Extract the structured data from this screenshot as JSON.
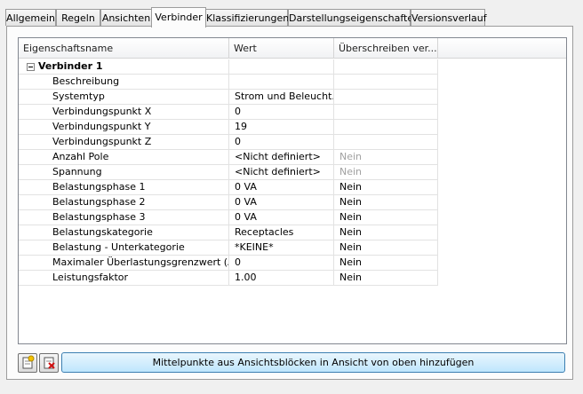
{
  "tabs": [
    {
      "label": "Allgemein",
      "active": false
    },
    {
      "label": "Regeln",
      "active": false
    },
    {
      "label": "Ansichten",
      "active": false
    },
    {
      "label": "Verbinder",
      "active": true
    },
    {
      "label": "Klassifizierungen",
      "active": false
    },
    {
      "label": "Darstellungseigenschaften",
      "active": false
    },
    {
      "label": "Versionsverlauf",
      "active": false
    }
  ],
  "grid": {
    "columns": [
      "Eigenschaftsname",
      "Wert",
      "Überschreiben ver..."
    ],
    "group": {
      "label": "Verbinder 1",
      "expander_icon": "collapse-minus-icon"
    },
    "rows": [
      {
        "name": "Beschreibung",
        "value": "",
        "override": ""
      },
      {
        "name": "Systemtyp",
        "value": "Strom und Beleucht...",
        "override": ""
      },
      {
        "name": "Verbindungspunkt X",
        "value": "0",
        "override": ""
      },
      {
        "name": "Verbindungspunkt Y",
        "value": "19",
        "override": ""
      },
      {
        "name": "Verbindungspunkt Z",
        "value": "0",
        "override": ""
      },
      {
        "name": "Anzahl Pole",
        "value": "<Nicht definiert>",
        "override": "Nein",
        "override_disabled": true
      },
      {
        "name": "Spannung",
        "value": "<Nicht definiert>",
        "override": "Nein",
        "override_disabled": true
      },
      {
        "name": "Belastungsphase 1",
        "value": "0 VA",
        "override": "Nein"
      },
      {
        "name": "Belastungsphase 2",
        "value": "0 VA",
        "override": "Nein"
      },
      {
        "name": "Belastungsphase 3",
        "value": "0 VA",
        "override": "Nein"
      },
      {
        "name": "Belastungskategorie",
        "value": "Receptacles",
        "override": "Nein"
      },
      {
        "name": "Belastung - Unterkategorie",
        "value": "*KEINE*",
        "override": "Nein"
      },
      {
        "name": "Maximaler Überlastungsgrenzwert (Am...",
        "value": "0",
        "override": "Nein"
      },
      {
        "name": "Leistungsfaktor",
        "value": "1.00",
        "override": "Nein"
      }
    ]
  },
  "toolbar": {
    "add_icon": "add-connector-icon",
    "remove_icon": "remove-connector-icon",
    "main_button_label": "Mittelpunkte aus Ansichtsblöcken in Ansicht von oben hinzufügen"
  }
}
